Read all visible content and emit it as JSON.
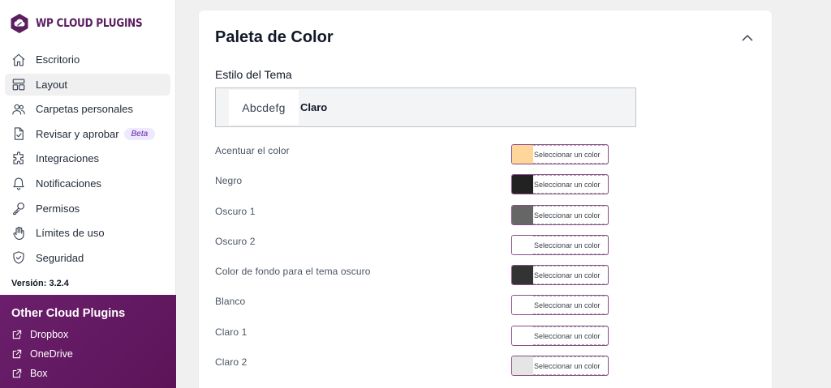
{
  "brand": {
    "name": "WP CLOUD PLUGINS"
  },
  "sidebar": {
    "items": [
      {
        "label": "Escritorio",
        "icon": "home-icon"
      },
      {
        "label": "Layout",
        "icon": "layout-icon",
        "active": true
      },
      {
        "label": "Carpetas personales",
        "icon": "users-icon"
      },
      {
        "label": "Revisar y aprobar",
        "icon": "document-check-icon",
        "badge": "Beta"
      },
      {
        "label": "Integraciones",
        "icon": "puzzle-icon"
      },
      {
        "label": "Notificaciones",
        "icon": "bell-icon"
      },
      {
        "label": "Permisos",
        "icon": "key-icon"
      },
      {
        "label": "Límites de uso",
        "icon": "hand-icon"
      },
      {
        "label": "Seguridad",
        "icon": "shield-check-icon"
      }
    ],
    "version": "Versión: 3.2.4"
  },
  "other_plugins": {
    "title": "Other Cloud Plugins",
    "links": [
      {
        "label": "Dropbox",
        "icon": "external-link-icon"
      },
      {
        "label": "OneDrive",
        "icon": "external-link-icon"
      },
      {
        "label": "Box",
        "icon": "external-link-icon"
      }
    ]
  },
  "panel": {
    "title": "Paleta de Color",
    "theme": {
      "label": "Estilo del Tema",
      "preview": "Abcdefg",
      "name": "Claro"
    },
    "button_text": "Seleccionar un color",
    "colors": [
      {
        "label": "Acentuar el color",
        "value": "#ffd699"
      },
      {
        "label": "Negro",
        "value": "#222222"
      },
      {
        "label": "Oscuro 1",
        "value": "#666666"
      },
      {
        "label": "Oscuro 2",
        "value": "#ffffff"
      },
      {
        "label": "Color de fondo para el tema oscuro",
        "value": "#333333"
      },
      {
        "label": "Blanco",
        "value": "#ffffff"
      },
      {
        "label": "Claro 1",
        "value": "#ffffff"
      },
      {
        "label": "Claro 2",
        "value": "#e5e5e5"
      }
    ]
  },
  "colors": {
    "brand": "#5b1e5f",
    "sidebar_promo": "#6b1f6c",
    "badge_bg": "#ede9fe",
    "active_bg": "#f0f0f1"
  }
}
